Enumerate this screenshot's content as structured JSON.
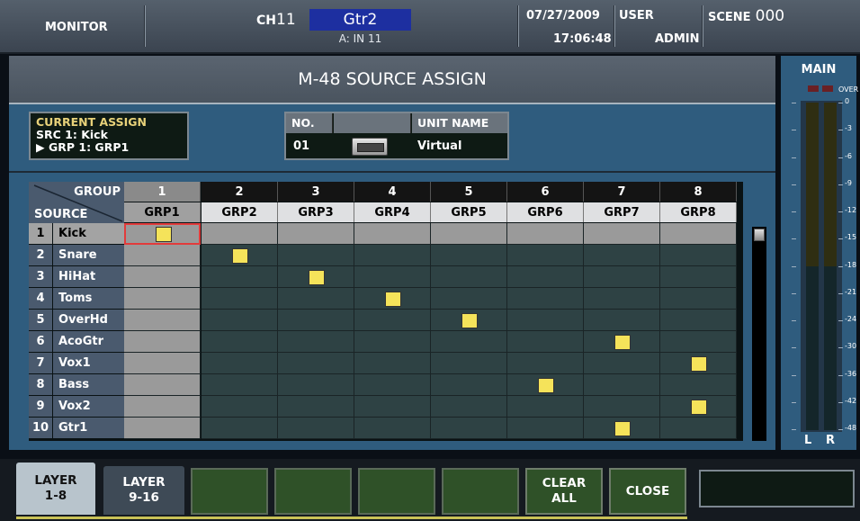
{
  "header": {
    "screen": "MONITOR",
    "channel_prefix": "CH",
    "channel_number": "11",
    "channel_name": "Gtr2",
    "channel_input": "A: IN 11",
    "date": "07/27/2009",
    "time": "17:06:48",
    "user_label": "USER",
    "user_name": "ADMIN",
    "scene_label": "SCENE",
    "scene_number": "000"
  },
  "page_title": "M-48 SOURCE ASSIGN",
  "current_assign": {
    "label": "CURRENT ASSIGN",
    "source": "SRC  1: Kick",
    "group_marker": "▶",
    "group": "GRP  1: GRP1"
  },
  "unit": {
    "no_label": "NO.",
    "name_label": "UNIT NAME",
    "no_value": "01",
    "name_value": "Virtual"
  },
  "grid": {
    "corner_group": "GROUP",
    "corner_source": "SOURCE",
    "group_numbers": [
      "1",
      "2",
      "3",
      "4",
      "5",
      "6",
      "7",
      "8"
    ],
    "group_names": [
      "GRP1",
      "GRP2",
      "GRP3",
      "GRP4",
      "GRP5",
      "GRP6",
      "GRP7",
      "GRP8"
    ],
    "sources": [
      {
        "num": "1",
        "name": "Kick",
        "group": 1
      },
      {
        "num": "2",
        "name": "Snare",
        "group": 2
      },
      {
        "num": "3",
        "name": "HiHat",
        "group": 3
      },
      {
        "num": "4",
        "name": "Toms",
        "group": 4
      },
      {
        "num": "5",
        "name": "OverHd",
        "group": 5
      },
      {
        "num": "6",
        "name": "AcoGtr",
        "group": 7
      },
      {
        "num": "7",
        "name": "Vox1",
        "group": 8
      },
      {
        "num": "8",
        "name": "Bass",
        "group": 6
      },
      {
        "num": "9",
        "name": "Vox2",
        "group": 8
      },
      {
        "num": "10",
        "name": "Gtr1",
        "group": 7
      }
    ],
    "selected_source": 1,
    "selected_group": 1
  },
  "meter": {
    "title": "MAIN",
    "over_label": "OVER",
    "scale": [
      "0",
      "-3",
      "-6",
      "-9",
      "-12",
      "-15",
      "-18",
      "-21",
      "-24",
      "-30",
      "-36",
      "-42",
      "-48"
    ],
    "left_label": "L",
    "right_label": "R",
    "left_level": 0,
    "right_level": 0
  },
  "buttons": {
    "layer_1_8_line1": "LAYER",
    "layer_1_8_line2": "1-8",
    "layer_9_16_line1": "LAYER",
    "layer_9_16_line2": "9-16",
    "clear_all_line1": "CLEAR",
    "clear_all_line2": "ALL",
    "close": "CLOSE"
  },
  "colors": {
    "panel_blue": "#2f5c7e",
    "assign_marker": "#f5e35a",
    "selection_outline": "#e23b3b",
    "button_green": "#2f5128",
    "active_tab": "#b8c4cc"
  }
}
